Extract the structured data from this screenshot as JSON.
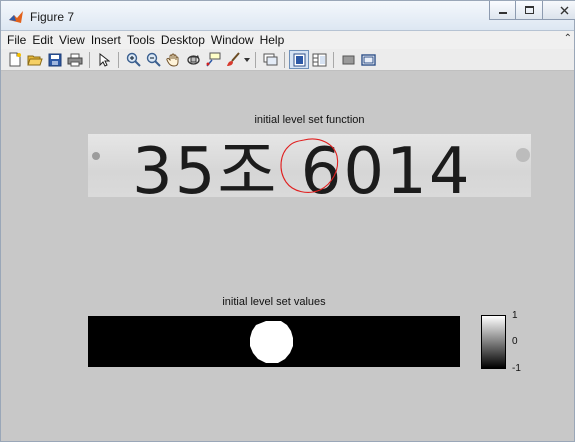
{
  "window": {
    "title": "Figure 7",
    "controls": [
      "minimize-icon",
      "maximize-icon",
      "close-icon"
    ]
  },
  "menubar": {
    "items": [
      "File",
      "Edit",
      "View",
      "Insert",
      "Tools",
      "Desktop",
      "Window",
      "Help"
    ],
    "overflow_arrow": "⌃"
  },
  "toolbar": {
    "buttons": [
      "new-figure-icon",
      "open-file-icon",
      "save-icon",
      "print-icon",
      "edit-plot-icon",
      "zoom-in-icon",
      "zoom-out-icon",
      "pan-icon",
      "rotate-3d-icon",
      "data-cursor-icon",
      "brush-icon",
      "link-plot-icon",
      "hide-plot-tools-icon",
      "show-plot-tools-icon",
      "legend-icon",
      "colorbar-icon"
    ],
    "pressed": "hide-plot-tools-icon"
  },
  "figure": {
    "background": "#c8c8c8",
    "axes1": {
      "title": "initial level set function",
      "image_text": "35조 6014",
      "contour_color": "#e02020"
    },
    "axes2": {
      "title": "initial level set values",
      "colorbar": {
        "ticks": [
          "1",
          "0",
          "-1"
        ],
        "colormap": "gray"
      }
    }
  }
}
